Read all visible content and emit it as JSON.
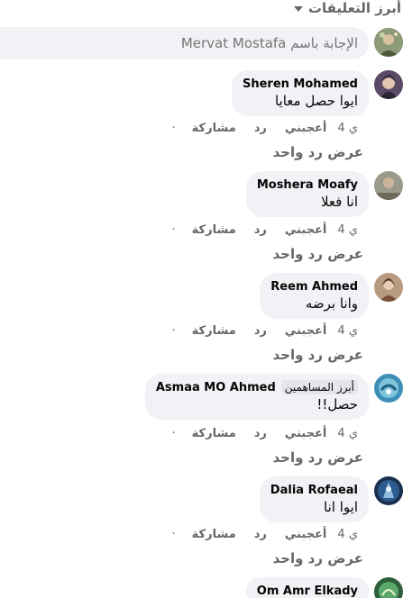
{
  "filter": {
    "label": "أبرز التعليقات"
  },
  "reply_box": {
    "placeholder": "الإجابة باسم Mervat Mostafa"
  },
  "comments": [
    {
      "author": "Sheren Mohamed",
      "text": "ايوا حصل معايا",
      "time": "4 ي",
      "like": "أعجبني",
      "reply": "رد",
      "share": "مشاركة",
      "dot": "·",
      "view_replies": "عرض رد واحد"
    },
    {
      "author": "Moshera Moafy",
      "text": "انا فعلا",
      "time": "4 ي",
      "like": "أعجبني",
      "reply": "رد",
      "share": "مشاركة",
      "dot": "·",
      "view_replies": "عرض رد واحد"
    },
    {
      "author": "Reem Ahmed",
      "text": "وانا برضه",
      "time": "4 ي",
      "like": "أعجبني",
      "reply": "رد",
      "share": "مشاركة",
      "dot": "·",
      "view_replies": "عرض رد واحد"
    },
    {
      "author": "Asmaa MO Ahmed",
      "badge": "أبرز المساهمين",
      "text": "حصل!!",
      "time": "4 ي",
      "like": "أعجبني",
      "reply": "رد",
      "share": "مشاركة",
      "dot": "·",
      "view_replies": "عرض رد واحد"
    },
    {
      "author": "Dalia Rofaeal",
      "text": "ايوا انا",
      "time": "4 ي",
      "like": "أعجبني",
      "reply": "رد",
      "share": "مشاركة",
      "dot": "·",
      "view_replies": "عرض رد واحد"
    },
    {
      "author": "Om Amr Elkady"
    }
  ],
  "colors": {
    "bubble": "#f0f2f5",
    "secondary_text": "#65676b",
    "primary_text": "#050505",
    "badge_bg": "#e4e6eb"
  }
}
